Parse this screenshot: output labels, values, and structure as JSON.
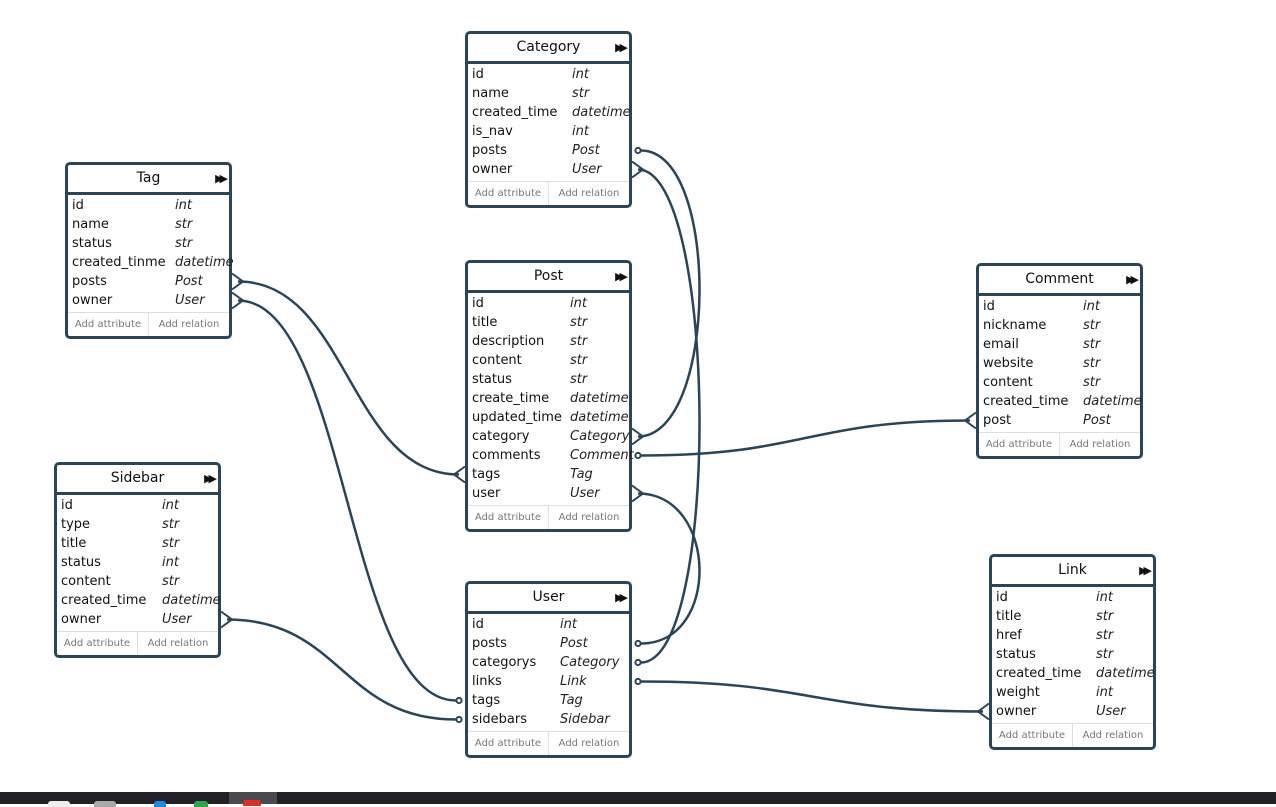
{
  "diagram": {
    "edge_color": "#2b4456",
    "footer": {
      "add_attribute": "Add attribute",
      "add_relation": "Add relation"
    },
    "expand_icon": "fast-forward-icon",
    "tables": [
      {
        "id": "category",
        "name": "Category",
        "fields": [
          [
            "id",
            "int"
          ],
          [
            "name",
            "str"
          ],
          [
            "created_time",
            "datetime"
          ],
          [
            "is_nav",
            "int"
          ],
          [
            "posts",
            "Post"
          ],
          [
            "owner",
            "User"
          ]
        ]
      },
      {
        "id": "tag",
        "name": "Tag",
        "fields": [
          [
            "id",
            "int"
          ],
          [
            "name",
            "str"
          ],
          [
            "status",
            "str"
          ],
          [
            "created_tinme",
            "datetime"
          ],
          [
            "posts",
            "Post"
          ],
          [
            "owner",
            "User"
          ]
        ]
      },
      {
        "id": "post",
        "name": "Post",
        "fields": [
          [
            "id",
            "int"
          ],
          [
            "title",
            "str"
          ],
          [
            "description",
            "str"
          ],
          [
            "content",
            "str"
          ],
          [
            "status",
            "str"
          ],
          [
            "create_time",
            "datetime"
          ],
          [
            "updated_time",
            "datetime"
          ],
          [
            "category",
            "Category"
          ],
          [
            "comments",
            "Comment"
          ],
          [
            "tags",
            "Tag"
          ],
          [
            "user",
            "User"
          ]
        ]
      },
      {
        "id": "comment",
        "name": "Comment",
        "fields": [
          [
            "id",
            "int"
          ],
          [
            "nickname",
            "str"
          ],
          [
            "email",
            "str"
          ],
          [
            "website",
            "str"
          ],
          [
            "content",
            "str"
          ],
          [
            "created_time",
            "datetime"
          ],
          [
            "post",
            "Post"
          ]
        ]
      },
      {
        "id": "sidebar",
        "name": "Sidebar",
        "fields": [
          [
            "id",
            "int"
          ],
          [
            "type",
            "str"
          ],
          [
            "title",
            "str"
          ],
          [
            "status",
            "int"
          ],
          [
            "content",
            "str"
          ],
          [
            "created_time",
            "datetime"
          ],
          [
            "owner",
            "User"
          ]
        ]
      },
      {
        "id": "user",
        "name": "User",
        "fields": [
          [
            "id",
            "int"
          ],
          [
            "posts",
            "Post"
          ],
          [
            "categorys",
            "Category"
          ],
          [
            "links",
            "Link"
          ],
          [
            "tags",
            "Tag"
          ],
          [
            "sidebars",
            "Sidebar"
          ]
        ]
      },
      {
        "id": "link",
        "name": "Link",
        "fields": [
          [
            "id",
            "int"
          ],
          [
            "title",
            "str"
          ],
          [
            "href",
            "str"
          ],
          [
            "status",
            "str"
          ],
          [
            "created_time",
            "datetime"
          ],
          [
            "weight",
            "int"
          ],
          [
            "owner",
            "User"
          ]
        ]
      }
    ],
    "relations": [
      {
        "from": [
          "category",
          "posts",
          "one"
        ],
        "to": [
          "post",
          "category",
          "many"
        ]
      },
      {
        "from": [
          "category",
          "owner",
          "many"
        ],
        "to": [
          "user",
          "categorys",
          "one"
        ]
      },
      {
        "from": [
          "post",
          "user",
          "many"
        ],
        "to": [
          "user",
          "posts",
          "one"
        ]
      },
      {
        "from": [
          "tag",
          "posts",
          "many"
        ],
        "to": [
          "post",
          "tags",
          "many"
        ]
      },
      {
        "from": [
          "tag",
          "owner",
          "many"
        ],
        "to": [
          "user",
          "tags",
          "one"
        ]
      },
      {
        "from": [
          "sidebar",
          "owner",
          "many"
        ],
        "to": [
          "user",
          "sidebars",
          "one"
        ]
      },
      {
        "from": [
          "post",
          "comments",
          "one"
        ],
        "to": [
          "comment",
          "post",
          "many"
        ]
      },
      {
        "from": [
          "user",
          "links",
          "one"
        ],
        "to": [
          "link",
          "owner",
          "many"
        ]
      }
    ]
  }
}
